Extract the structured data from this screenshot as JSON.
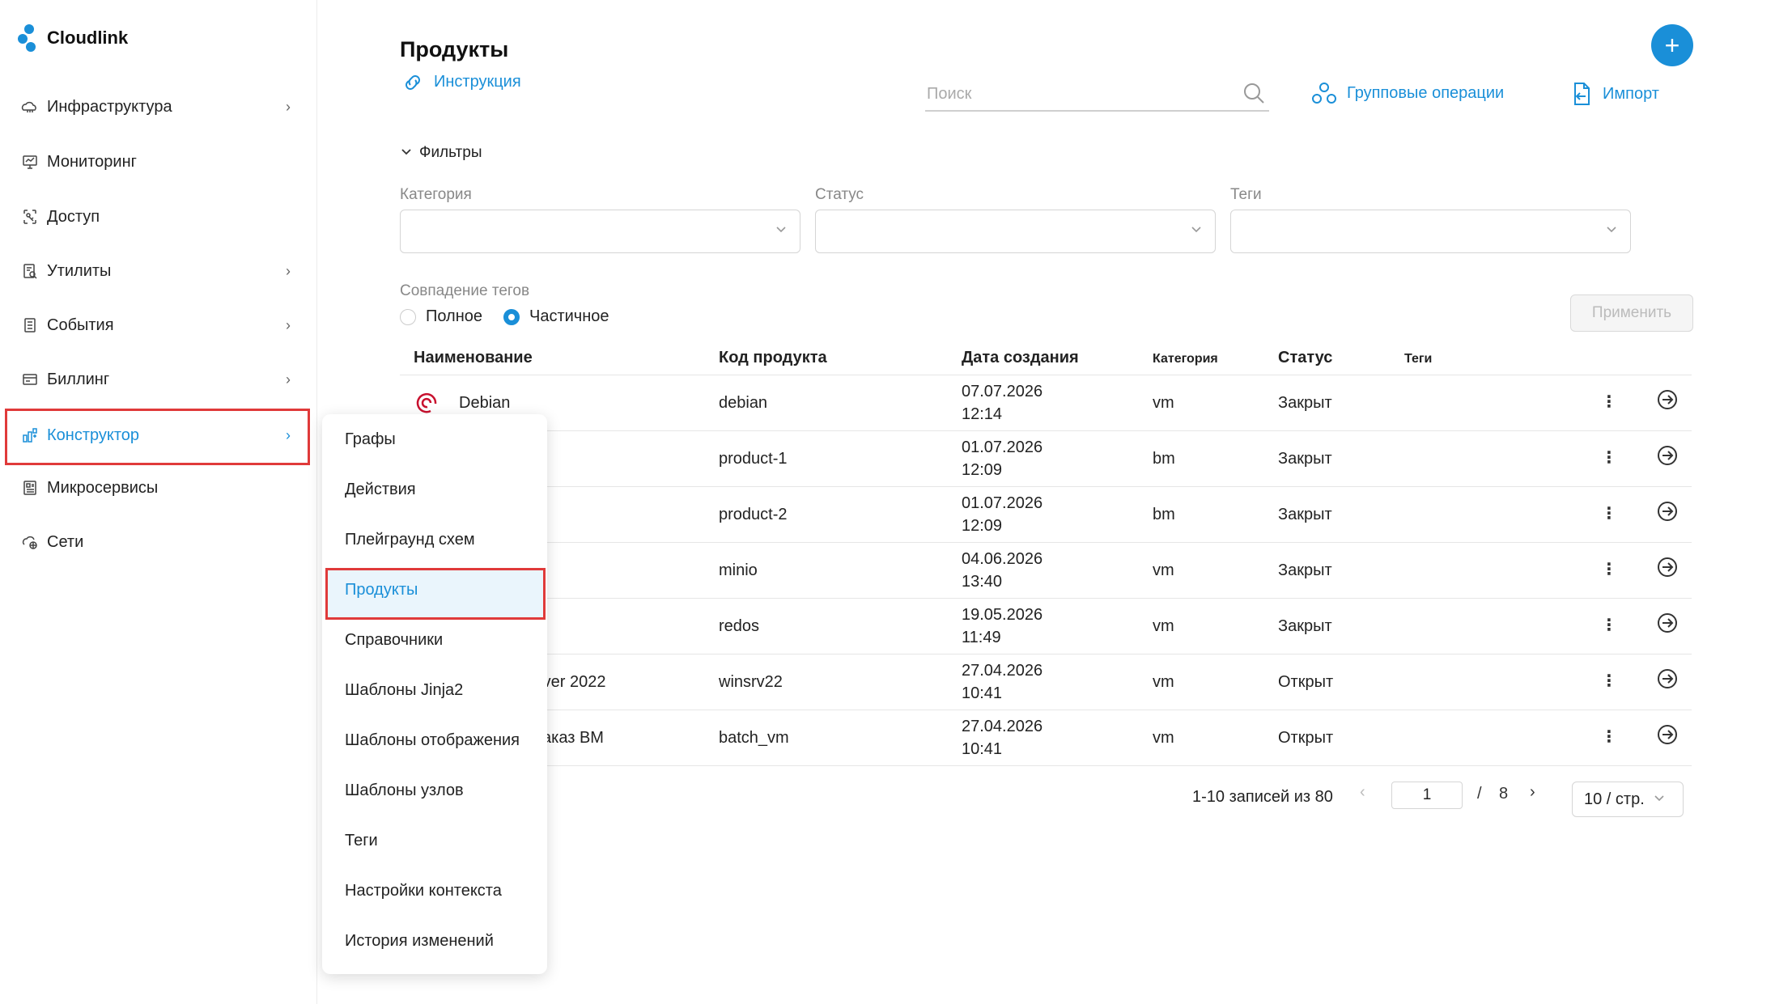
{
  "app": {
    "name": "Cloudlink",
    "brand_color": "#1a8fd8"
  },
  "sidebar": {
    "items": [
      {
        "label": "Инфраструктура",
        "icon": "infrastructure-icon",
        "has_children": true
      },
      {
        "label": "Мониторинг",
        "icon": "monitoring-icon",
        "has_children": false
      },
      {
        "label": "Доступ",
        "icon": "access-icon",
        "has_children": false
      },
      {
        "label": "Утилиты",
        "icon": "utilities-icon",
        "has_children": true
      },
      {
        "label": "События",
        "icon": "events-icon",
        "has_children": true
      },
      {
        "label": "Биллинг",
        "icon": "billing-icon",
        "has_children": true
      },
      {
        "label": "Конструктор",
        "icon": "constructor-icon",
        "has_children": true,
        "active": true
      },
      {
        "label": "Микросервисы",
        "icon": "microservices-icon",
        "has_children": false
      },
      {
        "label": "Сети",
        "icon": "network-icon",
        "has_children": false
      }
    ]
  },
  "submenu": {
    "items": [
      "Графы",
      "Действия",
      "Плейграунд схем",
      "Продукты",
      "Справочники",
      "Шаблоны Jinja2",
      "Шаблоны отображения",
      "Шаблоны узлов",
      "Теги",
      "Настройки контекста",
      "История изменений"
    ],
    "selected": "Продукты"
  },
  "header": {
    "title": "Продукты",
    "instruction_label": "Инструкция",
    "search_placeholder": "Поиск",
    "group_ops_label": "Групповые операции",
    "import_label": "Импорт",
    "add_label": "+"
  },
  "filters": {
    "toggle_label": "Фильтры",
    "category_label": "Категория",
    "status_label": "Статус",
    "tags_label": "Теги",
    "tag_match_label": "Совпадение тегов",
    "full_label": "Полное",
    "partial_label": "Частичное",
    "selected_match": "Частичное",
    "apply_label": "Применить"
  },
  "table": {
    "columns": [
      "Наименование",
      "Код продукта",
      "Дата создания",
      "Категория",
      "Статус",
      "Теги"
    ],
    "rows": [
      {
        "name": "Debian",
        "code": "debian",
        "date": "07.07.2026",
        "time": "12:14",
        "category": "vm",
        "status": "Закрыт"
      },
      {
        "name": "",
        "code": "product-1",
        "date": "01.07.2026",
        "time": "12:09",
        "category": "bm",
        "status": "Закрыт"
      },
      {
        "name": "",
        "code": "product-2",
        "date": "01.07.2026",
        "time": "12:09",
        "category": "bm",
        "status": "Закрыт"
      },
      {
        "name": "",
        "code": "minio",
        "date": "04.06.2026",
        "time": "13:40",
        "category": "vm",
        "status": "Закрыт"
      },
      {
        "name": "",
        "code": "redos",
        "date": "19.05.2026",
        "time": "11:49",
        "category": "vm",
        "status": "Закрыт"
      },
      {
        "name": "rver 2022",
        "code": "winsrv22",
        "date": "27.04.2026",
        "time": "10:41",
        "category": "vm",
        "status": "Открыт"
      },
      {
        "name": "аказ ВМ",
        "code": "batch_vm",
        "date": "27.04.2026",
        "time": "10:41",
        "category": "vm",
        "status": "Открыт"
      }
    ]
  },
  "pagination": {
    "summary": "1-10 записей из 80",
    "current_page": "1",
    "separator": "/",
    "total_pages": "8",
    "page_size": "10 / стр."
  }
}
